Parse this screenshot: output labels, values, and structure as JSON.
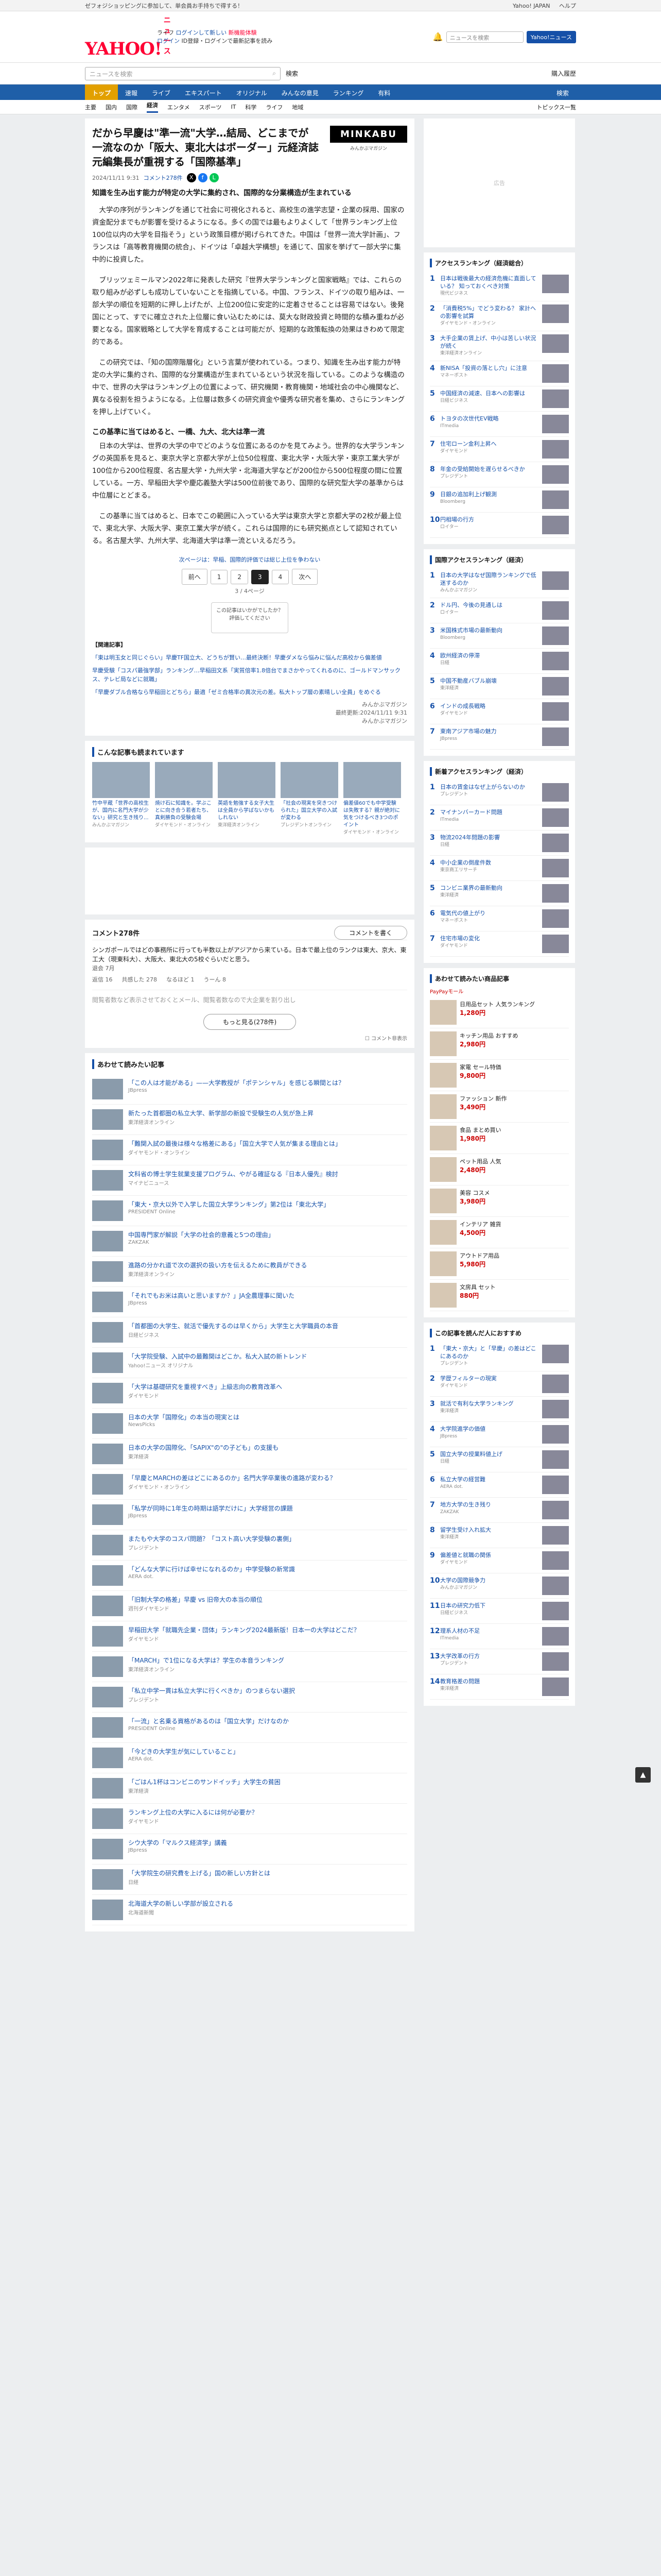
{
  "topbar": {
    "left": "ゼフォジショッピングに参加して、単会員お手持ちで得する！",
    "right": [
      "Yahoo! JAPAN",
      "ヘルプ"
    ]
  },
  "header": {
    "logo": "YAHOO!",
    "logo_sub": "ニュース",
    "line1": "ライフ",
    "line1b": "ログインして新しい",
    "line1r": "新機能体験",
    "line2": "ログイン",
    "line2b": "ID登録・ログインで最新記事を読み",
    "search_placeholder": "ニュースを検索",
    "search_btn": "Yahoo!ニュース"
  },
  "searchrow": {
    "placeholder": "ニュースを検索",
    "btn": "検索",
    "more": "購入履歴"
  },
  "nav": {
    "items": [
      "トップ",
      "速報",
      "ライブ",
      "エキスパート",
      "オリジナル",
      "みんなの意見",
      "ランキング",
      "有料"
    ],
    "active": 0,
    "search": "検索"
  },
  "subnav": {
    "items": [
      "主要",
      "国内",
      "国際",
      "経済",
      "エンタメ",
      "スポーツ",
      "IT",
      "科学",
      "ライフ",
      "地域"
    ],
    "active": 3,
    "more": "トピックス一覧"
  },
  "article": {
    "title": "だから早慶は\"準一流\"大学…結局、どこまでが一流なのか「阪大、東北大はボーダー」元経済誌元編集長が重視する「国際基準」",
    "brand": "MINKABU",
    "brand_sub": "みんかぶマガジン",
    "date": "2024/11/11 9:31",
    "comments": "コメント278件",
    "lead": "知識を生み出す能力が特定の大学に集約され、国際的な分業構造が生まれている",
    "paras": [
      "大学の序列がランキングを通じて社会に可視化されると、高校生の進学志望・企業の採用、国家の資金配分までもが影響を受けるようになる。多くの国では最もよりよくして「世界ランキング上位100位以内の大学を目指そう」という政策目標が掲げられてきた。中国は「世界一流大学計画」、フランスは「高等教育機関の統合」、ドイツは「卓越大学構想」を通じて、国家を挙げて一部大学に集中的に投資した。",
      "ブリッツェミールマン2022年に発表した研究『世界大学ランキングと国家戦略』では、これらの取り組みが必ずしも成功していないことを指摘している。中国、フランス、ドイツの取り組みは、一部大学の順位を短期的に押し上げたが、上位200位に安定的に定着させることは容易ではない。後発国にとって、すでに確立された上位層に食い込むためには、莫大な財政投資と時間的な積み重ねが必要となる。国家戦略として大学を育成することは可能だが、短期的な政策転換の効果はきわめて限定的である。",
      "この研究では、「知の国際階層化」という言葉が使われている。つまり、知識を生み出す能力が特定の大学に集約され、国際的な分業構造が生まれているという状況を指している。このような構造の中で、世界の大学はランキング上の位置によって、研究機関・教育機関・地域社会の中心機関など、異なる役割を担うようになる。上位層は数多くの研究資金や優秀な研究者を集め、さらにランキングを押し上げていく。"
    ],
    "h2": "この基準に当てはめると、一橋、九大、北大は準一流",
    "paras2": [
      "日本の大学は、世界の大学の中でどのような位置にあるのかを見てみよう。世界的な大学ランキングの英国系を見ると、東京大学と京都大学が上位50位程度、東北大学・大阪大学・東京工業大学が100位から200位程度、名古屋大学・九州大学・北海道大学などが200位から500位程度の間に位置している。一方、早稲田大学や慶応義塾大学は500位前後であり、国際的な研究型大学の基準からは中位層にとどまる。",
      "この基準に当てはめると、日本でこの範囲に入っている大学は東京大学と京都大学の2校が最上位で、東北大学、大阪大学、東京工業大学が続く。これらは国際的にも研究拠点として認知されている。名古屋大学、九州大学、北海道大学は準一流といえるだろう。"
    ],
    "fig_caption": "世界大学ランキングの推移",
    "pagelink": "次ページは：早稲、国際的評価では総じ上位を争わない",
    "pages": [
      "前へ",
      "1",
      "2",
      "3",
      "4",
      "次へ"
    ],
    "pagecur": 3,
    "pageinfo": "3 / 4ページ",
    "tooltip": "この記事はいかがでしたか？ 評価してください",
    "related_title": "【関連記事】",
    "related": [
      "「東は明玉女と同じぐらい」早慶TF国立大、どうちが賢い…最終決断！早慶ダメなら悩みに悩んだ高校から偏差値",
      "早慶受験「コスパ最強学部」ランキング…早稲田文系「実質倍率1.8倍台でまさかやってくれるのに、ゴールドマンサックス、テレビ局などに就職」",
      "「早慶ダブル合格なら早稲田とどちら」最適「ゼミ合格率の異次元の差。私大トップ層の素晴しい全員」をめぐる"
    ],
    "byline1": "みんかぶマガジン",
    "byline2": "最終更新:2024/11/11 9:31",
    "byline3": "みんかぶマガジン"
  },
  "sections": {
    "recommend_title": "こんな記事も読まれています",
    "cards": [
      {
        "t": "竹中平蔵「世界の高校生が、国内に名門大学が少ない」研究と生き残り...",
        "s": "みんかぶマガジン"
      },
      {
        "t": "焼け石に知識を。学ぶことに向き合う若者たち、真剣勝負の受験会場",
        "s": "ダイヤモンド・オンライン"
      },
      {
        "t": "英語を勉強する女子大生は全員から学ばないかもしれない",
        "s": "東洋経済オンライン"
      },
      {
        "t": "「社会の現実を突きつけられた」国立大学の入試が変わる",
        "s": "プレジデントオンライン"
      },
      {
        "t": "偏差値60でも中学受験は失敗する？親が絶対に気をつけるべき3つのポイント",
        "s": "ダイヤモンド・オンライン"
      }
    ],
    "comments_title": "コメント278件",
    "comments_btn": "コメントを書く",
    "comment_text": "シンガポールではどの事務所に行っても半数以上がアジアから来ている。日本で最上位のランクは東大、京大、東工大（現東科大）、大阪大、東北大の5校ぐらいだと思う。",
    "comment_user": "退会 7月",
    "comment_acts": [
      "返信 16",
      "共感した 278",
      "なるほど 1",
      "うーん 8"
    ],
    "comment2": "閲覧者数など表示させておくとメール、閲覧者数なので大企業を割り出し",
    "more_comments": "もっと見る(278件)",
    "checkbox": "コメント非表示",
    "next_title": "あわせて読みたい記事",
    "rec": [
      {
        "t": "「この人は才能がある」——大学教授が「ポテンシャル」を感じる瞬間とは？",
        "s": "JBpress"
      },
      {
        "t": "新たった首都圏の私立大学、新学部の新設で受験生の人気が急上昇",
        "s": "東洋経済オンライン"
      },
      {
        "t": "「難関入試の最後は様々な格差にある」「国立大学で人気が集まる理由とは」",
        "s": "ダイヤモンド・オンライン"
      },
      {
        "t": "文科省の博士学生就業支援プログラム、やがる確証なる『日本人優先』検討",
        "s": "マイナビニュース"
      },
      {
        "t": "「東大・京大以外で入学した国立大学ランキング」第2位は「東北大学」",
        "s": "PRESIDENT Online"
      },
      {
        "t": "中国専門家が解説「大学の社会的意義と5つの理由」",
        "s": "ZAKZAK"
      },
      {
        "t": "進路の分かれ道で次の選択の扱い方を伝えるために教員ができる",
        "s": "東洋経済オンライン"
      },
      {
        "t": "「それでもお米は高いと思いますか？」JA全農理事に聞いた",
        "s": "JBpress"
      },
      {
        "t": "「首都圏の大学生、就活で優先するのは早くから」大学生と大学職員の本音",
        "s": "日経ビジネス"
      },
      {
        "t": "「大学院受験、入試中の最難関はどこか。私大入試の新トレンド",
        "s": "Yahoo!ニュース オリジナル"
      },
      {
        "t": "「大学は基礎研究を重視すべき」上級志向の教育改革へ",
        "s": "ダイヤモンド"
      },
      {
        "t": "日本の大学「国際化」の本当の現実とは",
        "s": "NewsPicks"
      },
      {
        "t": "日本の大学の国際化、「SAPIX\"の\"の子ども」の支援も",
        "s": "東洋経済"
      },
      {
        "t": "「早慶とMARCHの差はどこにあるのか」名門大学卒業後の進路が変わる？",
        "s": "ダイヤモンド・オンライン"
      },
      {
        "t": "「私学が同時に1年生の時期は語学だけに」大学経営の課題",
        "s": "JBpress"
      },
      {
        "t": "またもや大学のコスパ問題？「コスト高い大学受験の裏側」",
        "s": "プレジデント"
      },
      {
        "t": "「どんな大学に行けば幸せになれるのか」中学受験の新常識",
        "s": "AERA dot."
      },
      {
        "t": "「旧制大学の格差」早慶 vs 旧帝大の本当の順位",
        "s": "週刊ダイヤモンド"
      },
      {
        "t": "早稲田大学「就職先企業・団体」ランキング2024最新版！日本一の大学はどこだ？",
        "s": "ダイヤモンド"
      },
      {
        "t": "「MARCH」で1位になる大学は？学生の本音ランキング",
        "s": "東洋経済オンライン"
      },
      {
        "t": "「私立中学一貫は私立大学に行くべきか」のつまらない選択",
        "s": "プレジデント"
      },
      {
        "t": "「一流」と名乗る資格があるのは「国立大学」だけなのか",
        "s": "PRESIDENT Online"
      },
      {
        "t": "「今どきの大学生が気にしていること」",
        "s": "AERA dot."
      },
      {
        "t": "「ごはん1杯はコンビニのサンドイッチ」大学生の貧困",
        "s": "東洋経済"
      },
      {
        "t": "ランキング上位の大学に入るには何が必要か？",
        "s": "ダイヤモンド"
      },
      {
        "t": "シウ大学の「マルクス経済学」講義",
        "s": "JBpress"
      },
      {
        "t": "「大学院生の研究費を上げる」国の新しい方針とは",
        "s": "日経"
      },
      {
        "t": "北海道大学の新しい学部が設立される",
        "s": "北海道新聞"
      }
    ]
  },
  "side": {
    "access_title": "アクセスランキング（経済総合）",
    "access": [
      {
        "t": "日本は戦後最大の経済危機に直面している？ 知っておくべき対策",
        "s": "現代ビジネス"
      },
      {
        "t": "「消費税5%」でどう変わる？ 家計への影響を試算",
        "s": "ダイヤモンド・オンライン"
      },
      {
        "t": "大手企業の賃上げ、中小は苦しい状況が続く",
        "s": "東洋経済オンライン"
      },
      {
        "t": "新NISA「投資の落とし穴」に注意",
        "s": "マネーポスト"
      },
      {
        "t": "中国経済の減速、日本への影響は",
        "s": "日経ビジネス"
      },
      {
        "t": "トヨタの次世代EV戦略",
        "s": "ITmedia"
      },
      {
        "t": "住宅ローン金利上昇へ",
        "s": "ダイヤモンド"
      },
      {
        "t": "年金の受給開始を遅らせるべきか",
        "s": "プレジデント"
      },
      {
        "t": "日銀の追加利上げ観測",
        "s": "Bloomberg"
      },
      {
        "t": "円相場の行方",
        "s": "ロイター"
      }
    ],
    "cat_title": "国際アクセスランキング（経済）",
    "cat": [
      {
        "t": "日本の大学はなぜ国際ランキングで低迷するのか",
        "s": "みんかぶマガジン"
      },
      {
        "t": "ドル円、今後の見通しは",
        "s": "ロイター"
      },
      {
        "t": "米国株式市場の最新動向",
        "s": "Bloomberg"
      },
      {
        "t": "欧州経済の停滞",
        "s": "日経"
      },
      {
        "t": "中国不動産バブル崩壊",
        "s": "東洋経済"
      },
      {
        "t": "インドの成長戦略",
        "s": "ダイヤモンド"
      },
      {
        "t": "東南アジア市場の魅力",
        "s": "JBpress"
      }
    ],
    "news_title": "新着アクセスランキング（経済）",
    "news": [
      {
        "t": "日本の賃金はなぜ上がらないのか",
        "s": "プレジデント"
      },
      {
        "t": "マイナンバーカード問題",
        "s": "ITmedia"
      },
      {
        "t": "物流2024年問題の影響",
        "s": "日経"
      },
      {
        "t": "中小企業の倒産件数",
        "s": "東京商工リサーチ"
      },
      {
        "t": "コンビニ業界の最新動向",
        "s": "東洋経済"
      },
      {
        "t": "電気代の値上がり",
        "s": "マネーポスト"
      },
      {
        "t": "住宅市場の変化",
        "s": "ダイヤモンド"
      }
    ],
    "promo_title": "あわせて読みたい商品記事",
    "promo_sub": "PayPayモール",
    "promo": [
      {
        "t": "日用品セット 人気ランキング",
        "p": "1,280円"
      },
      {
        "t": "キッチン用品 おすすめ",
        "p": "2,980円"
      },
      {
        "t": "家電 セール特価",
        "p": "9,800円"
      },
      {
        "t": "ファッション 新作",
        "p": "3,490円"
      },
      {
        "t": "食品 まとめ買い",
        "p": "1,980円"
      },
      {
        "t": "ペット用品 人気",
        "p": "2,480円"
      },
      {
        "t": "美容 コスメ",
        "p": "3,980円"
      },
      {
        "t": "インテリア 雑貨",
        "p": "4,500円"
      },
      {
        "t": "アウトドア用品",
        "p": "5,980円"
      },
      {
        "t": "文房具 セット",
        "p": "880円"
      }
    ],
    "ad": "広告",
    "promo2_title": "この記事を読んだ人におすすめ",
    "promo2": [
      {
        "t": "「東大・京大」と「早慶」の差はどこにあるのか",
        "s": "プレジデント"
      },
      {
        "t": "学歴フィルターの現実",
        "s": "ダイヤモンド"
      },
      {
        "t": "就活で有利な大学ランキング",
        "s": "東洋経済"
      },
      {
        "t": "大学院進学の価値",
        "s": "JBpress"
      },
      {
        "t": "国立大学の授業料値上げ",
        "s": "日経"
      },
      {
        "t": "私立大学の経営難",
        "s": "AERA dot."
      },
      {
        "t": "地方大学の生き残り",
        "s": "ZAKZAK"
      },
      {
        "t": "留学生受け入れ拡大",
        "s": "東洋経済"
      },
      {
        "t": "偏差値と就職の関係",
        "s": "ダイヤモンド"
      },
      {
        "t": "大学の国際競争力",
        "s": "みんかぶマガジン"
      },
      {
        "t": "日本の研究力低下",
        "s": "日経ビジネス"
      },
      {
        "t": "理系人材の不足",
        "s": "ITmedia"
      },
      {
        "t": "大学改革の行方",
        "s": "プレジデント"
      },
      {
        "t": "教育格差の問題",
        "s": "東洋経済"
      }
    ]
  },
  "scrolltop": "▲",
  "colors": {
    "brand": "#ff0033",
    "nav": "#1f5fa8",
    "accent": "#e2a000",
    "link": "#1550a8"
  }
}
